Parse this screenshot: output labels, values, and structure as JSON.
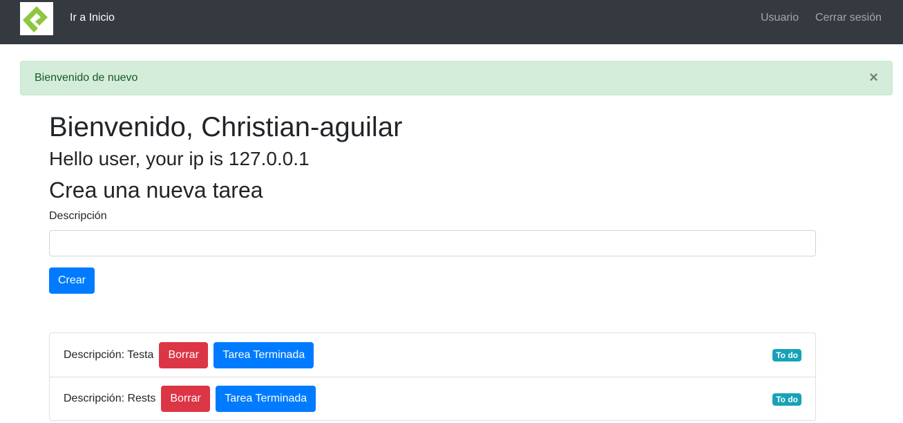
{
  "nav": {
    "brand_label": "Ir a Inicio",
    "user_label": "Usuario",
    "logout_label": "Cerrar sesión",
    "logo_icon": "logo-icon"
  },
  "alert": {
    "message": "Bienvenido de nuevo",
    "close_symbol": "×"
  },
  "main": {
    "welcome": "Bienvenido, Christian-aguilar",
    "ip_message": "Hello user, your ip is 127.0.0.1",
    "create_title": "Crea una nueva tarea",
    "description_label": "Descripción",
    "description_value": "",
    "create_button": "Crear"
  },
  "tasks": [
    {
      "description": "Descripción: Testa",
      "delete_label": "Borrar",
      "done_label": "Tarea Terminada",
      "status": "To do"
    },
    {
      "description": "Descripción: Rests",
      "delete_label": "Borrar",
      "done_label": "Tarea Terminada",
      "status": "To do"
    }
  ],
  "colors": {
    "navbar": "#343a40",
    "primary": "#007bff",
    "danger": "#dc3545",
    "info": "#17a2b8",
    "success_bg": "#d4edda",
    "logo_green": "#8dc63f"
  }
}
